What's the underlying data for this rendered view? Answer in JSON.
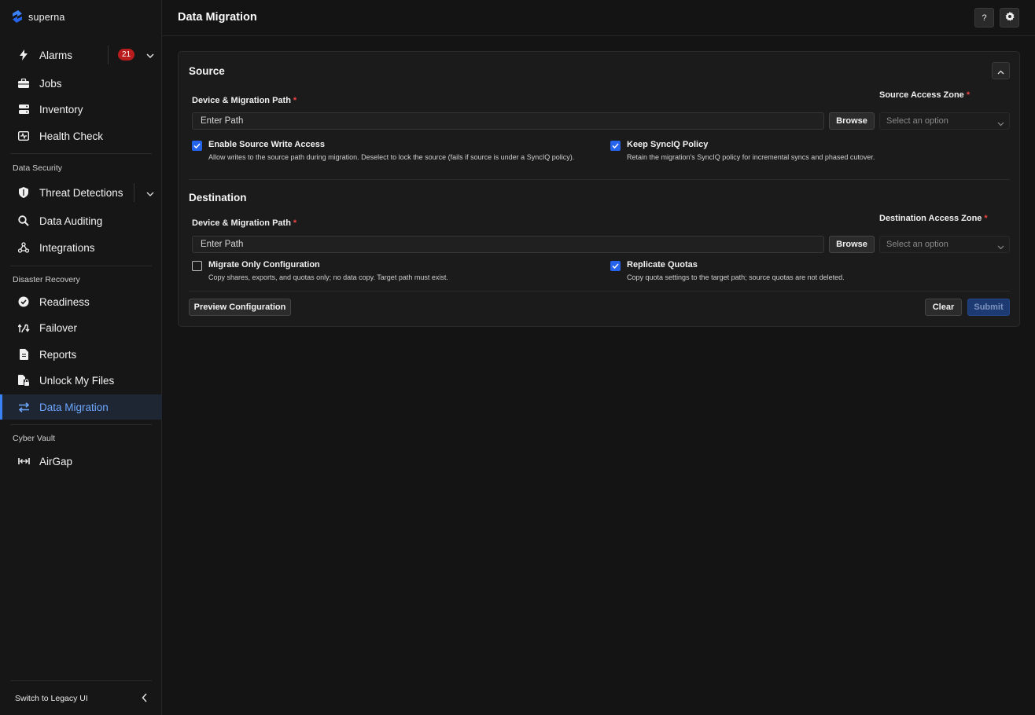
{
  "brand": {
    "name": "superna"
  },
  "sidebar": {
    "top_items": [
      {
        "label": "Alarms",
        "icon": "bolt-icon"
      },
      {
        "label": "Jobs",
        "icon": "briefcase-icon"
      },
      {
        "label": "Inventory",
        "icon": "server-icon"
      },
      {
        "label": "Health Check",
        "icon": "health-monitor-icon"
      }
    ],
    "alarms_badge": "21",
    "sections": [
      {
        "label": "Data Security",
        "items": [
          {
            "label": "Threat Detections",
            "icon": "shield-icon"
          },
          {
            "label": "Data Auditing",
            "icon": "magnifier-icon"
          },
          {
            "label": "Integrations",
            "icon": "webhook-icon"
          }
        ]
      },
      {
        "label": "Disaster Recovery",
        "items": [
          {
            "label": "Readiness",
            "icon": "check-circle-icon"
          },
          {
            "label": "Failover",
            "icon": "failover-icon"
          },
          {
            "label": "Reports",
            "icon": "document-icon"
          },
          {
            "label": "Unlock My Files",
            "icon": "file-lock-icon"
          },
          {
            "label": "Data Migration",
            "icon": "swap-arrows-icon",
            "active": true
          }
        ]
      },
      {
        "label": "Cyber Vault",
        "items": [
          {
            "label": "AirGap",
            "icon": "airgap-icon"
          }
        ]
      }
    ],
    "legacy_label": "Switch to Legacy UI"
  },
  "header": {
    "title": "Data Migration",
    "help_label": "?"
  },
  "source": {
    "title": "Source",
    "path_label": "Device & Migration Path",
    "path_placeholder": "Enter Path",
    "browse_label": "Browse",
    "zone_label": "Source Access Zone",
    "zone_placeholder": "Select an option",
    "write_access": {
      "title": "Enable Source Write Access",
      "desc": "Allow writes to the source path during migration. Deselect to lock the source (fails if source is under a SyncIQ policy).",
      "checked": true
    },
    "synciq": {
      "title": "Keep SyncIQ Policy",
      "desc": "Retain the migration's SyncIQ policy for incremental syncs and phased cutover.",
      "checked": true
    }
  },
  "destination": {
    "title": "Destination",
    "path_label": "Device & Migration Path",
    "path_placeholder": "Enter Path",
    "browse_label": "Browse",
    "zone_label": "Destination Access Zone",
    "zone_placeholder": "Select an option",
    "config_only": {
      "title": "Migrate Only Configuration",
      "desc": "Copy shares, exports, and quotas only; no data copy. Target path must exist.",
      "checked": false
    },
    "quotas": {
      "title": "Replicate Quotas",
      "desc": "Copy quota settings to the target path; source quotas are not deleted.",
      "checked": true
    }
  },
  "actions": {
    "preview_label": "Preview Configuration",
    "clear_label": "Clear",
    "submit_label": "Submit"
  },
  "required_mark": "*",
  "colors": {
    "accent": "#3b82f6",
    "badge": "#b91c1c",
    "required": "#ef4444",
    "background": "#141414"
  }
}
